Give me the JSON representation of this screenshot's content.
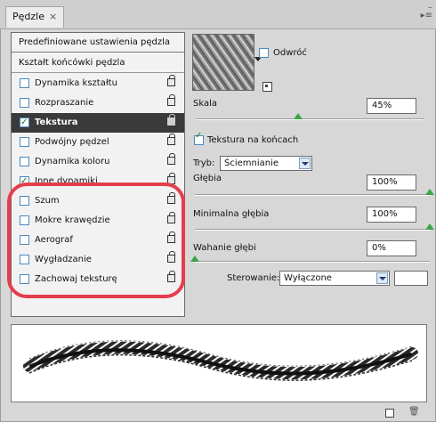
{
  "tab": {
    "title": "Pędzle",
    "close": "×"
  },
  "left": {
    "presets_label": "Predefiniowane ustawienia pędzla",
    "shape_label": "Kształt końcówki pędzla",
    "items": [
      {
        "label": "Dynamika kształtu",
        "checked": false,
        "selected": false
      },
      {
        "label": "Rozpraszanie",
        "checked": false,
        "selected": false
      },
      {
        "label": "Tekstura",
        "checked": true,
        "selected": true
      },
      {
        "label": "Podwójny pędzel",
        "checked": false,
        "selected": false
      },
      {
        "label": "Dynamika koloru",
        "checked": false,
        "selected": false
      },
      {
        "label": "Inne dynamiki",
        "checked": true,
        "selected": false
      },
      {
        "label": "Szum",
        "checked": false,
        "selected": false
      },
      {
        "label": "Mokre krawędzie",
        "checked": false,
        "selected": false
      },
      {
        "label": "Aerograf",
        "checked": false,
        "selected": false
      },
      {
        "label": "Wygładzanie",
        "checked": false,
        "selected": false
      },
      {
        "label": "Zachowaj teksturę",
        "checked": false,
        "selected": false
      }
    ]
  },
  "texture": {
    "invert_label": "Odwróć",
    "scale_label": "Skala",
    "scale_value": "45%",
    "each_tip_label": "Tekstura na końcach",
    "mode_label": "Tryb:",
    "mode_value": "Ściemnianie",
    "depth_label": "Głębia",
    "depth_value": "100%",
    "min_depth_label": "Minimalna głębia",
    "min_depth_value": "100%",
    "depth_jitter_label": "Wahanie głębi",
    "depth_jitter_value": "0%",
    "control_label": "Sterowanie:",
    "control_value": "Wyłączone",
    "control_extra_value": ""
  },
  "sliders": {
    "scale": 0.45,
    "depth": 1.0,
    "min_depth": 1.0,
    "depth_jitter": 0.0
  },
  "colors": {
    "highlight": "#e63d4c",
    "selected_row": "#3a3a3a",
    "knob": "#3ca44a"
  }
}
